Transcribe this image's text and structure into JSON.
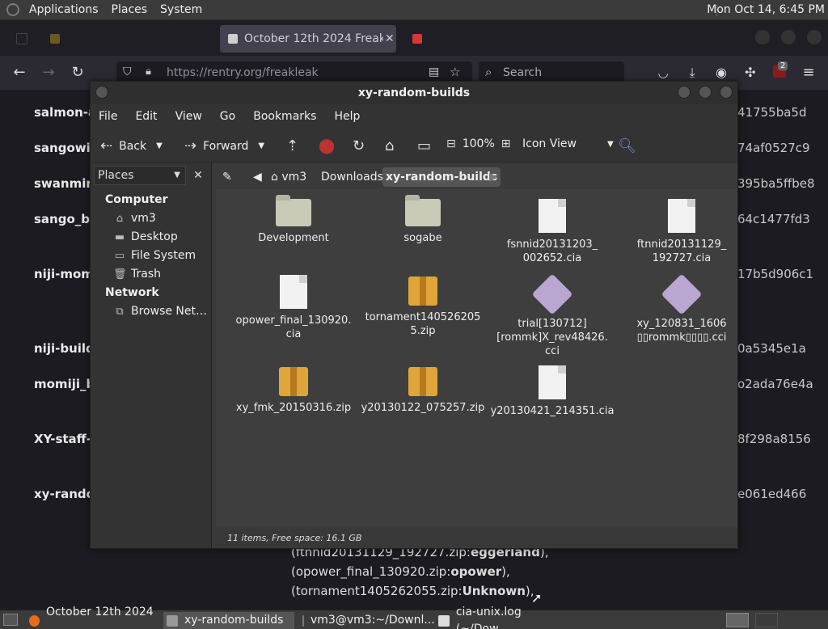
{
  "top_panel": {
    "menus": [
      "Applications",
      "Places",
      "System"
    ],
    "clock": "Mon Oct 14,  6:45 PM"
  },
  "firefox": {
    "active_tab_title": "October 12th 2024 Freakleak",
    "url": "https://rentry.org/freakleak",
    "search_placeholder": "Search",
    "badge_count": "2"
  },
  "webpage": {
    "left_labels": [
      "salmon-a",
      "sangowik",
      "swanmirr",
      "sango_bu",
      "niji-mom",
      "niji-builds",
      "momiji_b",
      "XY-staff-",
      "xy-randor"
    ],
    "right_hashes": [
      "41755ba5d",
      "74af0527c9",
      "395ba5ffbe8",
      "64c1477fd3",
      "17b5d906c1",
      "0a5345e1a",
      "o2ada76e4a",
      "8f298a8156",
      "e061ed466"
    ],
    "bottom_lines": [
      {
        "prefix": "(ftnnid20131129_192727.zip:",
        "bold": "eggerland",
        "suffix": "),"
      },
      {
        "prefix": "(opower_final_130920.zip:",
        "bold": "opower",
        "suffix": "),"
      },
      {
        "prefix": "(tornament1405262055.zip:",
        "bold": "Unknown",
        "suffix": "),"
      }
    ]
  },
  "caja": {
    "title": "xy-random-builds",
    "menu": [
      "File",
      "Edit",
      "View",
      "Go",
      "Bookmarks",
      "Help"
    ],
    "toolbar": {
      "back": "Back",
      "forward": "Forward",
      "zoom": "100%",
      "view_mode": "Icon View"
    },
    "sidebar": {
      "selector": "Places",
      "sections": [
        {
          "heading": "Computer",
          "items": [
            "vm3",
            "Desktop",
            "File System",
            "Trash"
          ]
        },
        {
          "heading": "Network",
          "items": [
            "Browse Net…"
          ]
        }
      ]
    },
    "breadcrumb": [
      "vm3",
      "Downloads",
      "xy-random-builds"
    ],
    "files": [
      {
        "name": "Development",
        "type": "folder"
      },
      {
        "name": "sogabe",
        "type": "folder"
      },
      {
        "name": "fsnnid20131203_\n002652.cia",
        "type": "doc"
      },
      {
        "name": "ftnnid20131129_\n192727.cia",
        "type": "doc"
      },
      {
        "name": "opower_final_130920.\ncia",
        "type": "doc"
      },
      {
        "name": "tornament140526205\n5.zip",
        "type": "zip"
      },
      {
        "name": "trial[130712]\n[rommk]X_rev48426.\ncci",
        "type": "cci"
      },
      {
        "name": "xy_120831_1606\n▯▯rommk▯▯▯▯.cci",
        "type": "cci"
      },
      {
        "name": "xy_fmk_20150316.zip",
        "type": "zip"
      },
      {
        "name": "y20130122_075257.zip",
        "type": "zip"
      },
      {
        "name": "y20130421_214351.cia",
        "type": "doc"
      }
    ],
    "status": "11 items, Free space: 16.1 GB"
  },
  "taskbar": {
    "tasks": [
      "October 12th 2024 ...",
      "xy-random-builds",
      "vm3@vm3:~/Downl...",
      "cia-unix.log (~/Dow..."
    ]
  }
}
